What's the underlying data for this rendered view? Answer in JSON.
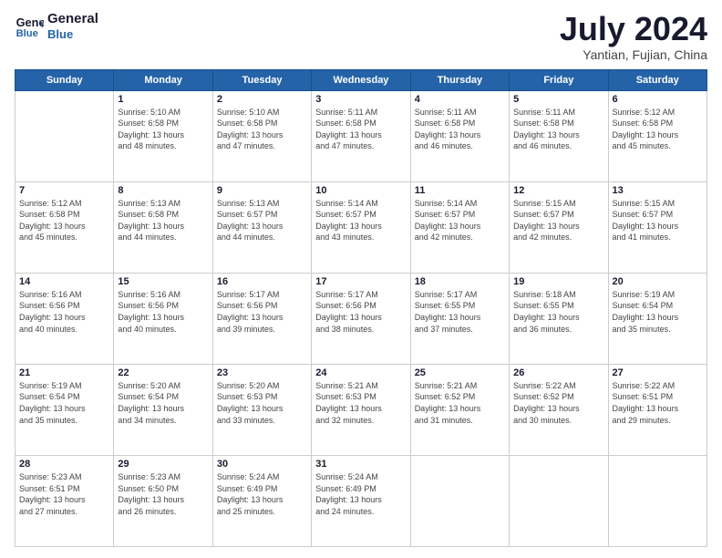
{
  "header": {
    "logo_line1": "General",
    "logo_line2": "Blue",
    "month_title": "July 2024",
    "subtitle": "Yantian, Fujian, China"
  },
  "days_of_week": [
    "Sunday",
    "Monday",
    "Tuesday",
    "Wednesday",
    "Thursday",
    "Friday",
    "Saturday"
  ],
  "weeks": [
    [
      {
        "day": "",
        "info": ""
      },
      {
        "day": "1",
        "info": "Sunrise: 5:10 AM\nSunset: 6:58 PM\nDaylight: 13 hours\nand 48 minutes."
      },
      {
        "day": "2",
        "info": "Sunrise: 5:10 AM\nSunset: 6:58 PM\nDaylight: 13 hours\nand 47 minutes."
      },
      {
        "day": "3",
        "info": "Sunrise: 5:11 AM\nSunset: 6:58 PM\nDaylight: 13 hours\nand 47 minutes."
      },
      {
        "day": "4",
        "info": "Sunrise: 5:11 AM\nSunset: 6:58 PM\nDaylight: 13 hours\nand 46 minutes."
      },
      {
        "day": "5",
        "info": "Sunrise: 5:11 AM\nSunset: 6:58 PM\nDaylight: 13 hours\nand 46 minutes."
      },
      {
        "day": "6",
        "info": "Sunrise: 5:12 AM\nSunset: 6:58 PM\nDaylight: 13 hours\nand 45 minutes."
      }
    ],
    [
      {
        "day": "7",
        "info": "Sunrise: 5:12 AM\nSunset: 6:58 PM\nDaylight: 13 hours\nand 45 minutes."
      },
      {
        "day": "8",
        "info": "Sunrise: 5:13 AM\nSunset: 6:58 PM\nDaylight: 13 hours\nand 44 minutes."
      },
      {
        "day": "9",
        "info": "Sunrise: 5:13 AM\nSunset: 6:57 PM\nDaylight: 13 hours\nand 44 minutes."
      },
      {
        "day": "10",
        "info": "Sunrise: 5:14 AM\nSunset: 6:57 PM\nDaylight: 13 hours\nand 43 minutes."
      },
      {
        "day": "11",
        "info": "Sunrise: 5:14 AM\nSunset: 6:57 PM\nDaylight: 13 hours\nand 42 minutes."
      },
      {
        "day": "12",
        "info": "Sunrise: 5:15 AM\nSunset: 6:57 PM\nDaylight: 13 hours\nand 42 minutes."
      },
      {
        "day": "13",
        "info": "Sunrise: 5:15 AM\nSunset: 6:57 PM\nDaylight: 13 hours\nand 41 minutes."
      }
    ],
    [
      {
        "day": "14",
        "info": "Sunrise: 5:16 AM\nSunset: 6:56 PM\nDaylight: 13 hours\nand 40 minutes."
      },
      {
        "day": "15",
        "info": "Sunrise: 5:16 AM\nSunset: 6:56 PM\nDaylight: 13 hours\nand 40 minutes."
      },
      {
        "day": "16",
        "info": "Sunrise: 5:17 AM\nSunset: 6:56 PM\nDaylight: 13 hours\nand 39 minutes."
      },
      {
        "day": "17",
        "info": "Sunrise: 5:17 AM\nSunset: 6:56 PM\nDaylight: 13 hours\nand 38 minutes."
      },
      {
        "day": "18",
        "info": "Sunrise: 5:17 AM\nSunset: 6:55 PM\nDaylight: 13 hours\nand 37 minutes."
      },
      {
        "day": "19",
        "info": "Sunrise: 5:18 AM\nSunset: 6:55 PM\nDaylight: 13 hours\nand 36 minutes."
      },
      {
        "day": "20",
        "info": "Sunrise: 5:19 AM\nSunset: 6:54 PM\nDaylight: 13 hours\nand 35 minutes."
      }
    ],
    [
      {
        "day": "21",
        "info": "Sunrise: 5:19 AM\nSunset: 6:54 PM\nDaylight: 13 hours\nand 35 minutes."
      },
      {
        "day": "22",
        "info": "Sunrise: 5:20 AM\nSunset: 6:54 PM\nDaylight: 13 hours\nand 34 minutes."
      },
      {
        "day": "23",
        "info": "Sunrise: 5:20 AM\nSunset: 6:53 PM\nDaylight: 13 hours\nand 33 minutes."
      },
      {
        "day": "24",
        "info": "Sunrise: 5:21 AM\nSunset: 6:53 PM\nDaylight: 13 hours\nand 32 minutes."
      },
      {
        "day": "25",
        "info": "Sunrise: 5:21 AM\nSunset: 6:52 PM\nDaylight: 13 hours\nand 31 minutes."
      },
      {
        "day": "26",
        "info": "Sunrise: 5:22 AM\nSunset: 6:52 PM\nDaylight: 13 hours\nand 30 minutes."
      },
      {
        "day": "27",
        "info": "Sunrise: 5:22 AM\nSunset: 6:51 PM\nDaylight: 13 hours\nand 29 minutes."
      }
    ],
    [
      {
        "day": "28",
        "info": "Sunrise: 5:23 AM\nSunset: 6:51 PM\nDaylight: 13 hours\nand 27 minutes."
      },
      {
        "day": "29",
        "info": "Sunrise: 5:23 AM\nSunset: 6:50 PM\nDaylight: 13 hours\nand 26 minutes."
      },
      {
        "day": "30",
        "info": "Sunrise: 5:24 AM\nSunset: 6:49 PM\nDaylight: 13 hours\nand 25 minutes."
      },
      {
        "day": "31",
        "info": "Sunrise: 5:24 AM\nSunset: 6:49 PM\nDaylight: 13 hours\nand 24 minutes."
      },
      {
        "day": "",
        "info": ""
      },
      {
        "day": "",
        "info": ""
      },
      {
        "day": "",
        "info": ""
      }
    ]
  ]
}
